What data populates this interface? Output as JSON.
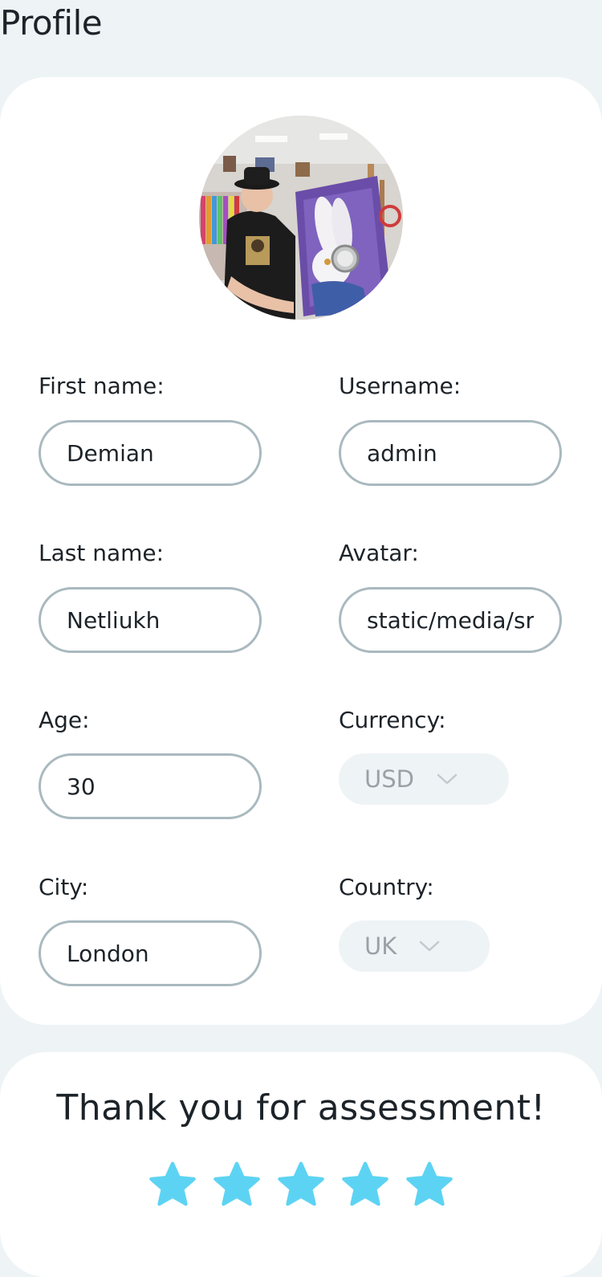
{
  "page": {
    "title": "Profile"
  },
  "profile": {
    "fields": {
      "first_name": {
        "label": "First name:",
        "value": "Demian"
      },
      "username": {
        "label": "Username:",
        "value": "admin"
      },
      "last_name": {
        "label": "Last name:",
        "value": "Netliukh"
      },
      "avatar": {
        "label": "Avatar:",
        "value": "static/media/sr"
      },
      "age": {
        "label": "Age:",
        "value": "30"
      },
      "currency": {
        "label": "Currency:",
        "value": "USD"
      },
      "city": {
        "label": "City:",
        "value": "London"
      },
      "country": {
        "label": "Country:",
        "value": "UK"
      }
    }
  },
  "assessment": {
    "title": "Thank you for assessment!",
    "rating": 5,
    "max_rating": 5,
    "star_color": "#5dd3f3",
    "icon": "star-icon"
  },
  "colors": {
    "background": "#eef3f6",
    "card": "#ffffff",
    "input_border": "#a9b9bf",
    "select_text": "#9aa1a6"
  }
}
